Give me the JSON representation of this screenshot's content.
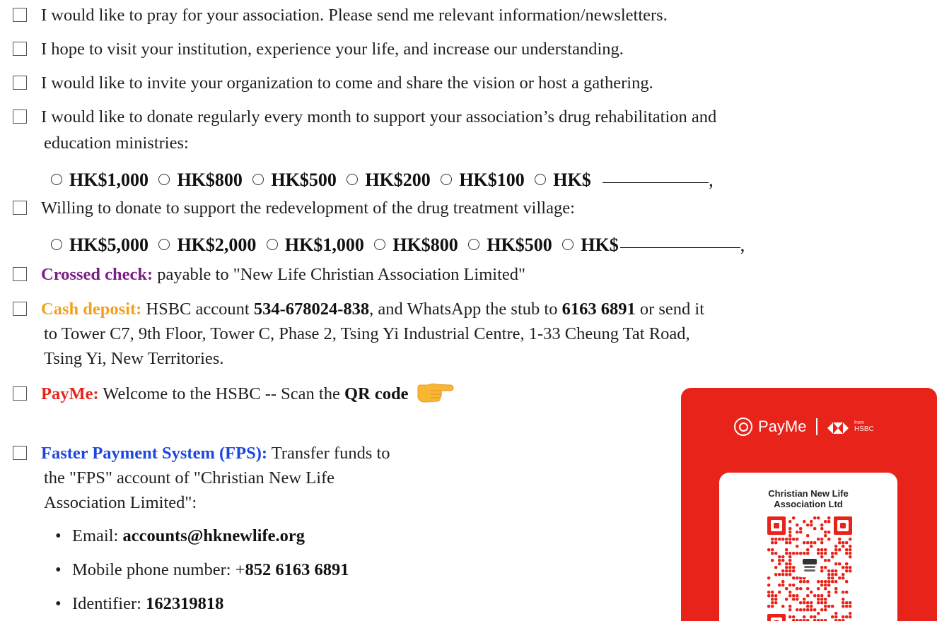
{
  "options": [
    {
      "text": "I would like to pray for your association. Please send me relevant information/newsletters."
    },
    {
      "text": "I hope to visit your institution, experience your life, and increase our understanding."
    },
    {
      "text": "I would like to invite your organization to come and share the vision or host a gathering."
    },
    {
      "text": "I would like to donate regularly every month to support your association’s drug rehabilitation and",
      "text2": "education ministries:"
    },
    {
      "text": "Willing to donate to support the redevelopment of the drug treatment village:"
    }
  ],
  "monthly_amounts": [
    "HK$1,000",
    "HK$800",
    "HK$500",
    "HK$200",
    "HK$100",
    "HK$"
  ],
  "village_amounts": [
    "HK$5,000",
    "HK$2,000",
    "HK$1,000",
    "HK$800",
    "HK$500",
    "HK$"
  ],
  "trailing_comma": ",",
  "payment": {
    "cheque": {
      "label": "Crossed check:",
      "text": " payable to \"New Life Christian Association Limited\""
    },
    "cash": {
      "label": "Cash deposit:",
      "t1": " HSBC account ",
      "account": "534-678024-838",
      "t2": ", and WhatsApp the stub to ",
      "phone": "6163 6891",
      "t3": " or send it",
      "line2": "to Tower C7, 9th Floor, Tower C, Phase 2, Tsing Yi Industrial Centre, 1-33 Cheung Tat Road,",
      "line3": "Tsing Yi, New Territories."
    },
    "payme": {
      "label": "PayMe:",
      "t1": " Welcome to the HSBC -- Scan the ",
      "bold": "QR code"
    },
    "fps": {
      "label": "Faster Payment System (FPS):",
      "t1": " Transfer funds to",
      "line2": "the \"FPS\" account of \"Christian New Life",
      "line3": "Association Limited\":",
      "bullets": [
        {
          "label": "Email: ",
          "value": "accounts@hknewlife.org"
        },
        {
          "label": "Mobile phone number: +",
          "value": "852 6163 6891"
        },
        {
          "label": "Identifier: ",
          "value": "162319818"
        }
      ]
    }
  },
  "card": {
    "brand": "PayMe",
    "from": "from",
    "hsbc": "HSBC",
    "org_line1": "Christian New Life",
    "org_line2": "Association Ltd"
  },
  "colors": {
    "crossed": "#7b1f86",
    "cash": "#f2a01e",
    "payme": "#e8241c",
    "fps": "#1c46e0",
    "card": "#e8231a"
  },
  "icons": [
    "checkbox-icon",
    "radio-icon",
    "pointing-hand-icon",
    "payme-logo-icon",
    "hsbc-logo-icon",
    "qr-code"
  ]
}
